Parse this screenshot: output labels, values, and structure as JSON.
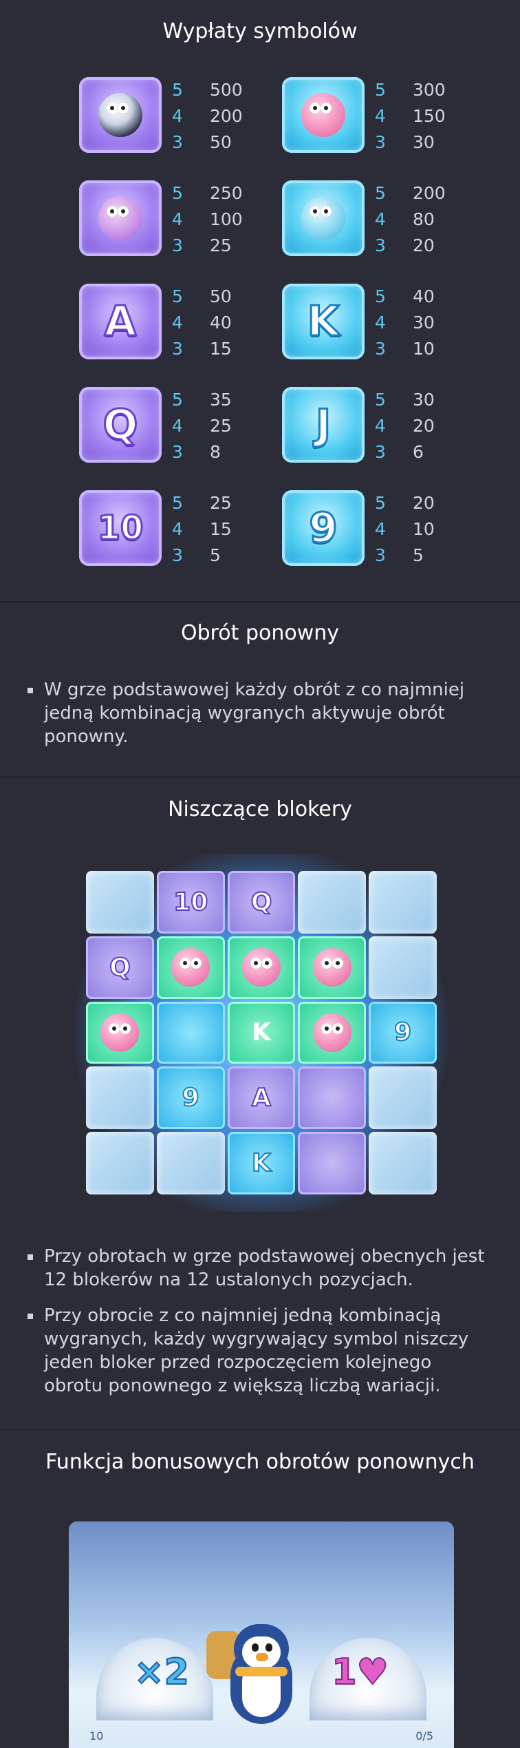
{
  "paytable": {
    "title": "Wypłaty symbolów",
    "items": [
      {
        "symbol": "penguin-icon",
        "style": "purple",
        "letter": "",
        "rows": [
          {
            "count": "5",
            "amount": "500"
          },
          {
            "count": "4",
            "amount": "200"
          },
          {
            "count": "3",
            "amount": "50"
          }
        ]
      },
      {
        "symbol": "pink-bird-icon",
        "style": "blue",
        "letter": "",
        "rows": [
          {
            "count": "5",
            "amount": "300"
          },
          {
            "count": "4",
            "amount": "150"
          },
          {
            "count": "3",
            "amount": "30"
          }
        ]
      },
      {
        "symbol": "squid-bird-icon",
        "style": "purple",
        "letter": "",
        "rows": [
          {
            "count": "5",
            "amount": "250"
          },
          {
            "count": "4",
            "amount": "100"
          },
          {
            "count": "3",
            "amount": "25"
          }
        ]
      },
      {
        "symbol": "blue-fish-icon",
        "style": "blue",
        "letter": "",
        "rows": [
          {
            "count": "5",
            "amount": "200"
          },
          {
            "count": "4",
            "amount": "80"
          },
          {
            "count": "3",
            "amount": "20"
          }
        ]
      },
      {
        "symbol": "letter-a-icon",
        "style": "purple",
        "letter": "A",
        "rows": [
          {
            "count": "5",
            "amount": "50"
          },
          {
            "count": "4",
            "amount": "40"
          },
          {
            "count": "3",
            "amount": "15"
          }
        ]
      },
      {
        "symbol": "letter-k-icon",
        "style": "blue",
        "letter": "K",
        "rows": [
          {
            "count": "5",
            "amount": "40"
          },
          {
            "count": "4",
            "amount": "30"
          },
          {
            "count": "3",
            "amount": "10"
          }
        ]
      },
      {
        "symbol": "letter-q-icon",
        "style": "purple",
        "letter": "Q",
        "rows": [
          {
            "count": "5",
            "amount": "35"
          },
          {
            "count": "4",
            "amount": "25"
          },
          {
            "count": "3",
            "amount": "8"
          }
        ]
      },
      {
        "symbol": "letter-j-icon",
        "style": "blue",
        "letter": "J",
        "rows": [
          {
            "count": "5",
            "amount": "30"
          },
          {
            "count": "4",
            "amount": "20"
          },
          {
            "count": "3",
            "amount": "6"
          }
        ]
      },
      {
        "symbol": "number-10-icon",
        "style": "purple",
        "letter": "10",
        "rows": [
          {
            "count": "5",
            "amount": "25"
          },
          {
            "count": "4",
            "amount": "15"
          },
          {
            "count": "3",
            "amount": "5"
          }
        ]
      },
      {
        "symbol": "number-9-icon",
        "style": "blue",
        "letter": "9",
        "rows": [
          {
            "count": "5",
            "amount": "20"
          },
          {
            "count": "4",
            "amount": "10"
          },
          {
            "count": "3",
            "amount": "5"
          }
        ]
      }
    ]
  },
  "respin": {
    "title": "Obrót ponowny",
    "bullets": [
      "W grze podstawowej każdy obrót z co najmniej jedną kombinacją wygranych aktywuje obrót ponowny."
    ]
  },
  "blockers": {
    "title": "Niszczące blokery",
    "bullets": [
      "Przy obrotach w grze podstawowej obecnych jest 12 blokerów na 12 ustalonych pozycjach.",
      "Przy obrocie z co najmniej jedną kombinacją wygranych, każdy wygrywający symbol niszczy jeden bloker przed rozpoczęciem kolejnego obrotu ponownego z większą liczbą wariacji."
    ],
    "grid": [
      [
        "ice",
        "lav:10",
        "lav:Q",
        "ice",
        "ice"
      ],
      [
        "lav:Q",
        "bird",
        "bird",
        "bird",
        "ice"
      ],
      [
        "bird",
        "cyan:",
        "green:K",
        "bird",
        "cyan:9"
      ],
      [
        "ice",
        "cyan:9",
        "lav:A",
        "lav:",
        "ice"
      ],
      [
        "ice",
        "ice",
        "cyan:K",
        "lav:",
        "ice"
      ]
    ]
  },
  "bonus": {
    "title": "Funkcja bonusowych obrotów ponownych",
    "multiplier": "×2",
    "hearts": "1♥",
    "left_counter": "10",
    "right_counter": "0/5"
  },
  "colors": {
    "background": "#2c2c38",
    "count": "#5ec8f0",
    "amount": "#d4d4dc",
    "purple_tile": "#9f7ff0",
    "blue_tile": "#52cdf2"
  }
}
